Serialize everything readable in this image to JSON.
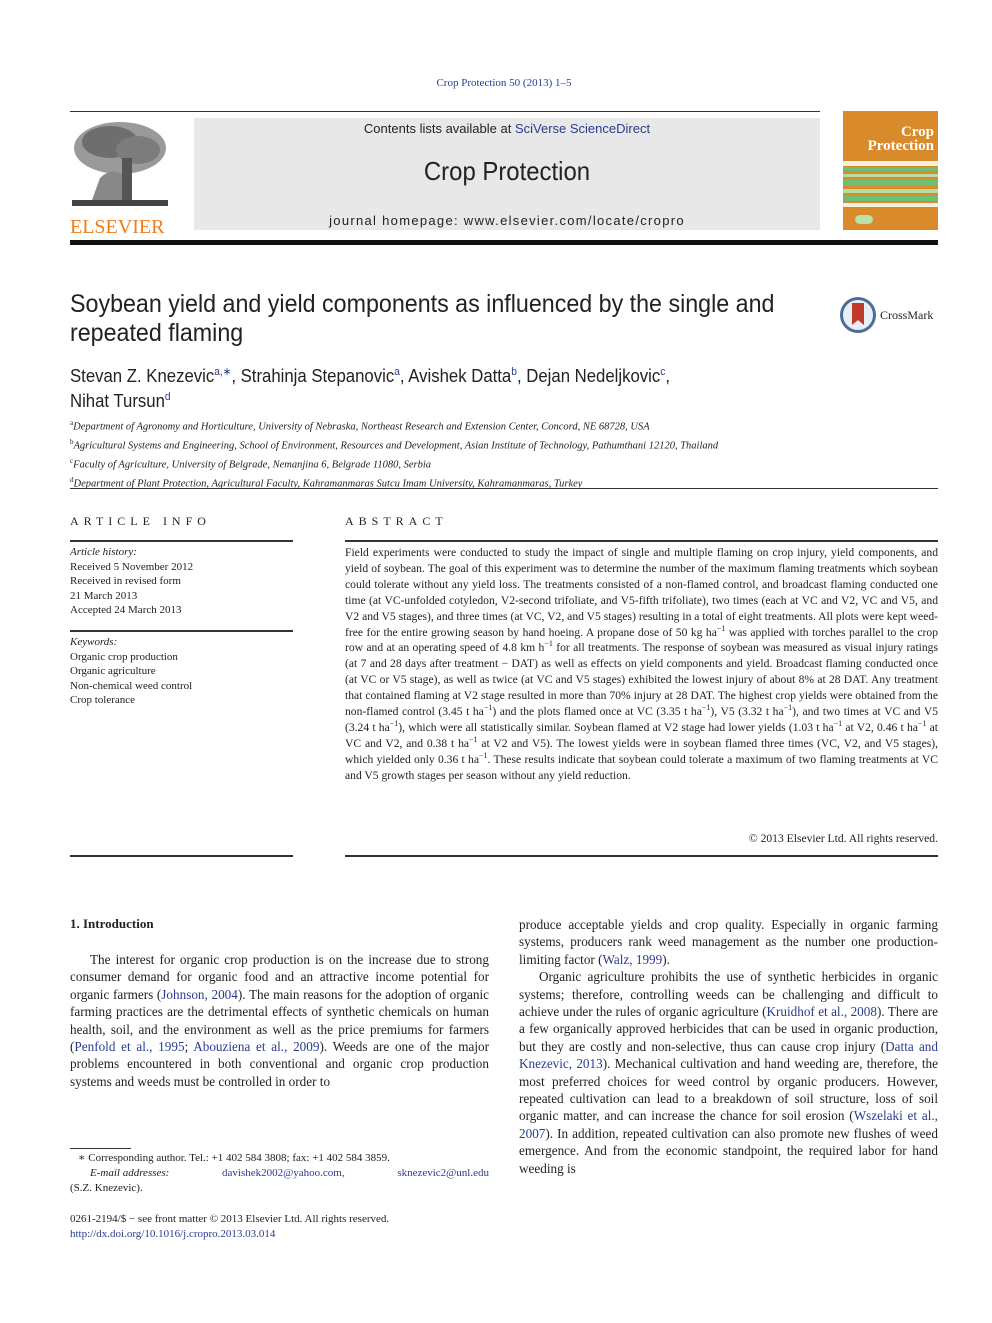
{
  "journal_ref": "Crop Protection 50 (2013) 1–5",
  "masthead": {
    "contents_prefix": "Contents lists available at ",
    "contents_link": "SciVerse ScienceDirect",
    "journal_name": "Crop Protection",
    "homepage": "journal homepage: www.elsevier.com/locate/cropro"
  },
  "publisher_logo": "ELSEVIER",
  "cover": {
    "title_line1": "Crop",
    "title_line2": "Protection"
  },
  "crossmark_label": "CrossMark",
  "colors": {
    "link": "#2a3c8e",
    "elsevier_orange": "#f07c1b",
    "cover_orange": "#d98b2c",
    "cover_green": "#6fbf73",
    "masthead_bg": "#e8e8e8"
  },
  "article": {
    "title": "Soybean yield and yield components as influenced by the single and repeated flaming",
    "authors": [
      {
        "name": "Stevan Z. Knezevic",
        "sup": "a,∗",
        "sep": ", "
      },
      {
        "name": "Strahinja Stepanovic",
        "sup": "a",
        "sep": ", "
      },
      {
        "name": "Avishek Datta",
        "sup": "b",
        "sep": ", "
      },
      {
        "name": "Dejan Nedeljkovic",
        "sup": "c",
        "sep": ", "
      },
      {
        "name": "Nihat Tursun",
        "sup": "d",
        "sep": ""
      }
    ],
    "affiliations": [
      {
        "key": "a",
        "text": "Department of Agronomy and Horticulture, University of Nebraska, Northeast Research and Extension Center, Concord, NE 68728, USA"
      },
      {
        "key": "b",
        "text": "Agricultural Systems and Engineering, School of Environment, Resources and Development, Asian Institute of Technology, Pathumthani 12120, Thailand"
      },
      {
        "key": "c",
        "text": "Faculty of Agriculture, University of Belgrade, Nemanjina 6, Belgrade 11080, Serbia"
      },
      {
        "key": "d",
        "text": "Department of Plant Protection, Agricultural Faculty, Kahramanmaras Sutcu Imam University, Kahramanmaras, Turkey"
      }
    ]
  },
  "article_info": {
    "heading": "ARTICLE INFO",
    "history_label": "Article history:",
    "history": [
      "Received 5 November 2012",
      "Received in revised form",
      "21 March 2013",
      "Accepted 24 March 2013"
    ],
    "keywords_label": "Keywords:",
    "keywords": [
      "Organic crop production",
      "Organic agriculture",
      "Non-chemical weed control",
      "Crop tolerance"
    ]
  },
  "abstract": {
    "heading": "ABSTRACT",
    "segments": [
      "Field experiments were conducted to study the impact of single and multiple flaming on crop injury, yield components, and yield of soybean. The goal of this experiment was to determine the number of the maximum flaming treatments which soybean could tolerate without any yield loss. The treatments consisted of a non-flamed control, and broadcast flaming conducted one time (at VC-unfolded cotyledon, V2-second trifoliate, and V5-fifth trifoliate), two times (each at VC and V2, VC and V5, and V2 and V5 stages), and three times (at VC, V2, and V5 stages) resulting in a total of eight treatments. All plots were kept weed-free for the entire growing season by hand hoeing. A propane dose of 50 kg ha",
      "−1",
      " was applied with torches parallel to the crop row and at an operating speed of 4.8 km h",
      "−1",
      " for all treatments. The response of soybean was measured as visual injury ratings (at 7 and 28 days after treatment − DAT) as well as effects on yield components and yield. Broadcast flaming conducted once (at VC or V5 stage), as well as twice (at VC and V5 stages) exhibited the lowest injury of about 8% at 28 DAT. Any treatment that contained flaming at V2 stage resulted in more than 70% injury at 28 DAT. The highest crop yields were obtained from the non-flamed control (3.45 t ha",
      "−1",
      ") and the plots flamed once at VC (3.35 t ha",
      "−1",
      "), V5 (3.32 t ha",
      "−1",
      "), and two times at VC and V5 (3.24 t ha",
      "−1",
      "), which were all statistically similar. Soybean flamed at V2 stage had lower yields (1.03 t ha",
      "−1",
      " at V2, 0.46 t ha",
      "−1",
      " at VC and V2, and 0.38 t ha",
      "−1",
      " at V2 and V5). The lowest yields were in soybean flamed three times (VC, V2, and V5 stages), which yielded only 0.36 t ha",
      "−1",
      ". These results indicate that soybean could tolerate a maximum of two flaming treatments at VC and V5 growth stages per season without any yield reduction."
    ],
    "copyright": "© 2013 Elsevier Ltd. All rights reserved."
  },
  "introduction": {
    "heading": "1.  Introduction",
    "col1_p1": [
      {
        "t": "The interest for organic crop production is on the increase due to strong consumer demand for organic food and an attractive income potential for organic farmers ("
      },
      {
        "t": "Johnson, 2004",
        "link": true
      },
      {
        "t": "). The main reasons for the adoption of organic farming practices are the detrimental effects of synthetic chemicals on human health, soil, and the environment as well as the price premiums for farmers ("
      },
      {
        "t": "Penfold et al., 1995",
        "link": true
      },
      {
        "t": "; "
      },
      {
        "t": "Abouziena et al., 2009",
        "link": true
      },
      {
        "t": "). Weeds are one of the major problems encountered in both conventional and organic crop production systems and weeds must be controlled in order to"
      }
    ],
    "col2_p1": [
      {
        "t": "produce acceptable yields and crop quality. Especially in organic farming systems, producers rank weed management as the number one production-limiting factor ("
      },
      {
        "t": "Walz, 1999",
        "link": true
      },
      {
        "t": ")."
      }
    ],
    "col2_p2": [
      {
        "t": "Organic agriculture prohibits the use of synthetic herbicides in organic systems; therefore, controlling weeds can be challenging and difficult to achieve under the rules of organic agriculture ("
      },
      {
        "t": "Kruidhof et al., 2008",
        "link": true
      },
      {
        "t": "). There are a few organically approved herbicides that can be used in organic production, but they are costly and non-selective, thus can cause crop injury ("
      },
      {
        "t": "Datta and Knezevic, 2013",
        "link": true
      },
      {
        "t": "). Mechanical cultivation and hand weeding are, therefore, the most preferred choices for weed control by organic producers. However, repeated cultivation can lead to a breakdown of soil structure, loss of soil organic matter, and can increase the chance for soil erosion ("
      },
      {
        "t": "Wszelaki et al., 2007",
        "link": true
      },
      {
        "t": "). In addition, repeated cultivation can also promote new flushes of weed emergence. And from the economic standpoint, the required labor for hand weeding is"
      }
    ]
  },
  "footnote": {
    "corresponding": "∗ Corresponding author. Tel.: +1 402 584 3808; fax: +1 402 584 3859.",
    "email_label": "E-mail addresses:",
    "email1": "davishek2002@yahoo.com,",
    "email2": "sknezevic2@unl.edu",
    "email_owner": "(S.Z. Knezevic)."
  },
  "front_matter": {
    "issn_line": "0261-2194/$ − see front matter © 2013 Elsevier Ltd. All rights reserved.",
    "doi": "http://dx.doi.org/10.1016/j.cropro.2013.03.014"
  }
}
